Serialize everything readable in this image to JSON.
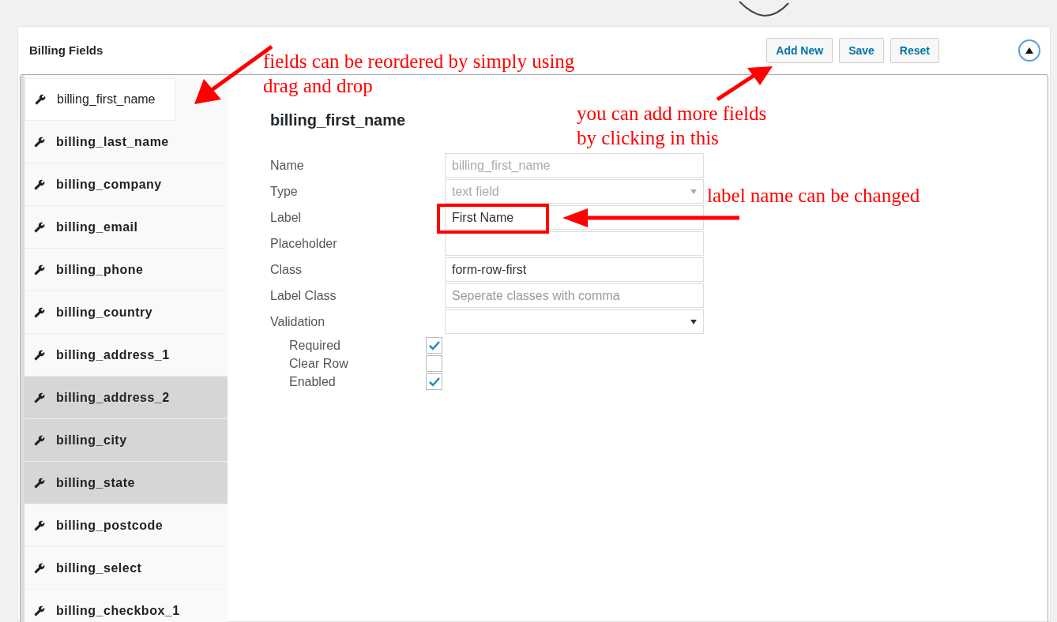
{
  "panel": {
    "title": "Billing Fields",
    "buttons": [
      "Add New",
      "Save",
      "Reset"
    ]
  },
  "fields": [
    {
      "label": "billing_first_name",
      "selected": true,
      "highlighted": false
    },
    {
      "label": "billing_last_name",
      "selected": false,
      "highlighted": false
    },
    {
      "label": "billing_company",
      "selected": false,
      "highlighted": false
    },
    {
      "label": "billing_email",
      "selected": false,
      "highlighted": false
    },
    {
      "label": "billing_phone",
      "selected": false,
      "highlighted": false
    },
    {
      "label": "billing_country",
      "selected": false,
      "highlighted": false
    },
    {
      "label": "billing_address_1",
      "selected": false,
      "highlighted": false
    },
    {
      "label": "billing_address_2",
      "selected": false,
      "highlighted": true
    },
    {
      "label": "billing_city",
      "selected": false,
      "highlighted": true
    },
    {
      "label": "billing_state",
      "selected": false,
      "highlighted": true
    },
    {
      "label": "billing_postcode",
      "selected": false,
      "highlighted": false
    },
    {
      "label": "billing_select",
      "selected": false,
      "highlighted": false
    },
    {
      "label": "billing_checkbox_1",
      "selected": false,
      "highlighted": false
    }
  ],
  "editor": {
    "heading": "billing_first_name",
    "rows": [
      {
        "kind": "input",
        "label": "Name",
        "value": "billing_first_name",
        "disabled": true
      },
      {
        "kind": "select",
        "label": "Type",
        "value": "text field",
        "disabled": true
      },
      {
        "kind": "input",
        "label": "Label",
        "value": "First Name"
      },
      {
        "kind": "input",
        "label": "Placeholder"
      },
      {
        "kind": "input",
        "label": "Class",
        "value": "form-row-first"
      },
      {
        "kind": "input",
        "label": "Label Class",
        "placeholder": "Seperate classes with comma"
      },
      {
        "kind": "select",
        "label": "Validation"
      }
    ],
    "checks": [
      {
        "label": "Required",
        "checked": true
      },
      {
        "label": "Clear Row",
        "checked": false
      },
      {
        "label": "Enabled",
        "checked": true
      }
    ]
  },
  "annotations": [
    "fields can be reordered by simply using drag and drop",
    "you can add more fields by clicking in this",
    "label name can be changed"
  ]
}
